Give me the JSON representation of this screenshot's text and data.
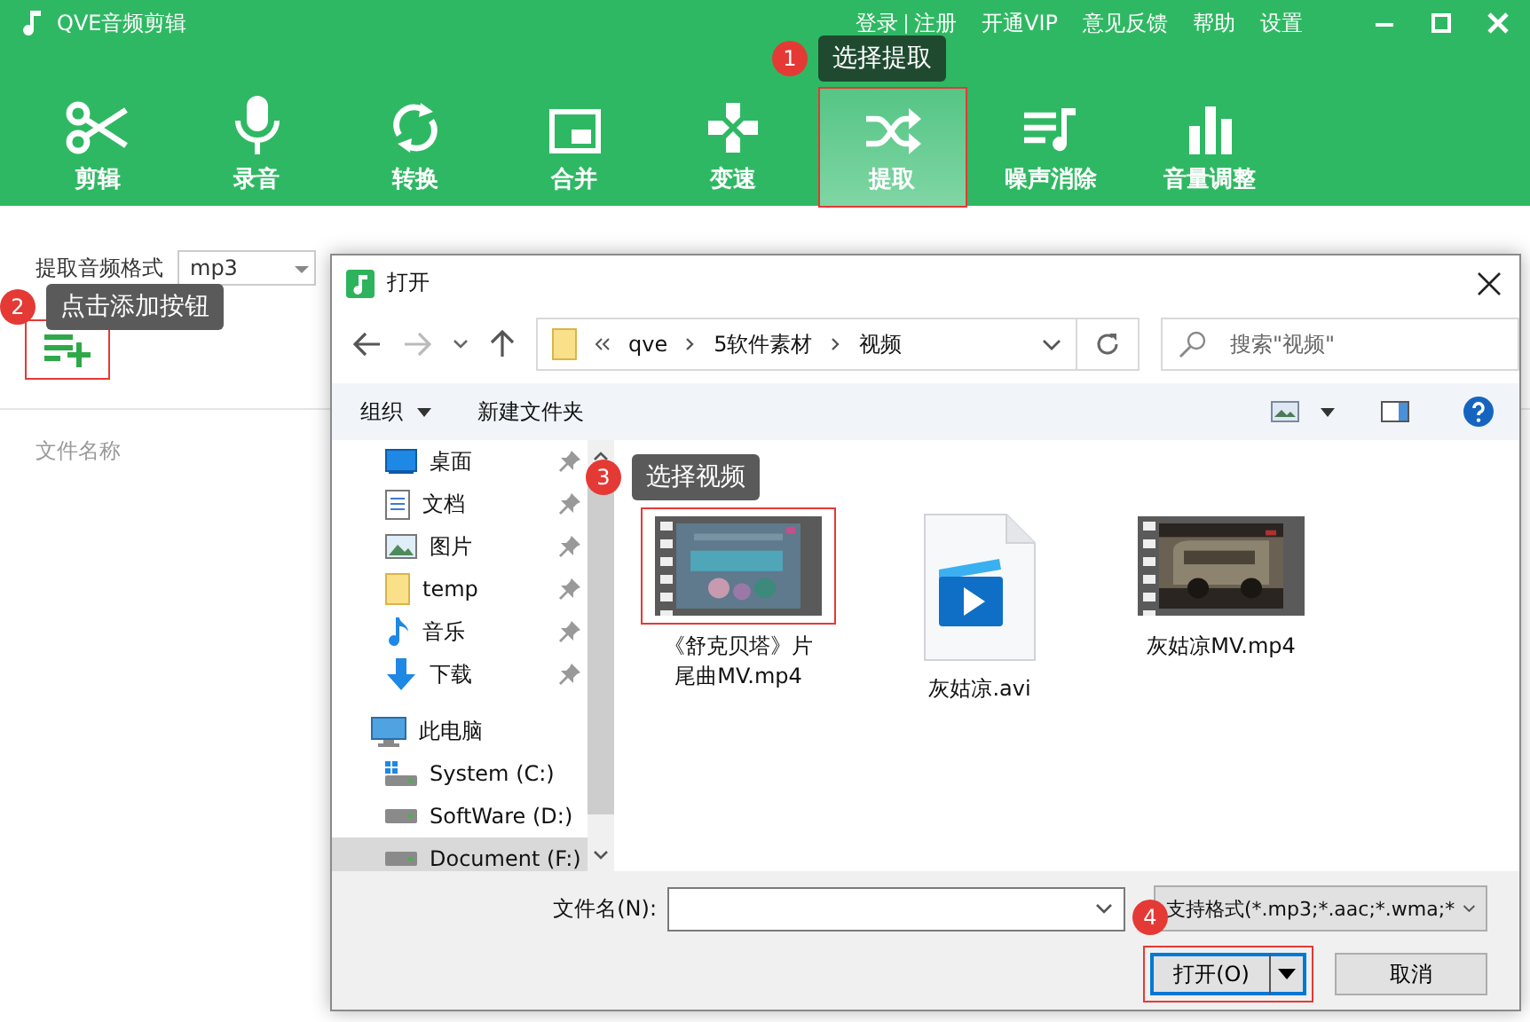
{
  "app": {
    "title": "QVE音频剪辑",
    "login": "登录",
    "register": "注册",
    "links": [
      "开通VIP",
      "意见反馈",
      "帮助",
      "设置"
    ]
  },
  "toolbar": [
    {
      "label": "剪辑",
      "selected": false,
      "highlighted": false
    },
    {
      "label": "录音",
      "selected": false,
      "highlighted": false
    },
    {
      "label": "转换",
      "selected": false,
      "highlighted": false
    },
    {
      "label": "合并",
      "selected": false,
      "highlighted": false
    },
    {
      "label": "变速",
      "selected": false,
      "highlighted": false
    },
    {
      "label": "提取",
      "selected": true,
      "highlighted": true
    },
    {
      "label": "噪声消除",
      "selected": false,
      "highlighted": false
    },
    {
      "label": "音量调整",
      "selected": false,
      "highlighted": false
    }
  ],
  "format": {
    "label": "提取音频格式",
    "value": "mp3"
  },
  "add_button": {
    "highlighted": true
  },
  "list_header": "文件名称",
  "dialog": {
    "title": "打开",
    "path": [
      "qve",
      "5软件素材",
      "视频"
    ],
    "search_placeholder": "搜索\"视频\"",
    "commands": [
      "组织",
      "新建文件夹"
    ],
    "quick_access": [
      {
        "label": "桌面",
        "pinned": true,
        "selected": false
      },
      {
        "label": "文档",
        "pinned": true,
        "selected": false
      },
      {
        "label": "图片",
        "pinned": true,
        "selected": false
      },
      {
        "label": "temp",
        "pinned": true,
        "selected": false
      },
      {
        "label": "音乐",
        "pinned": true,
        "selected": false
      },
      {
        "label": "下载",
        "pinned": true,
        "selected": false
      }
    ],
    "this_pc": {
      "label": "此电脑",
      "children": [
        {
          "label": "System (C:)",
          "selected": false
        },
        {
          "label": "SoftWare (D:)",
          "selected": false
        },
        {
          "label": "Document (F:)",
          "selected": true
        }
      ]
    },
    "files": [
      {
        "name": "《舒克贝塔》片尾曲MV.mp4",
        "kind": "video",
        "highlighted": true
      },
      {
        "name": "灰姑凉.avi",
        "kind": "file",
        "highlighted": false
      },
      {
        "name": "灰姑凉MV.mp4",
        "kind": "video",
        "highlighted": false
      }
    ],
    "filename_label": "文件名(N):",
    "filetype": "支持格式(*.mp3;*.aac;*.wma;*",
    "open_button": {
      "label": "打开(O)",
      "highlighted": true
    },
    "cancel_button": "取消"
  },
  "steps": [
    {
      "number": "1",
      "text": "选择提取"
    },
    {
      "number": "2",
      "text": "点击添加按钮"
    },
    {
      "number": "3",
      "text": "选择视频"
    },
    {
      "number": "4"
    }
  ]
}
